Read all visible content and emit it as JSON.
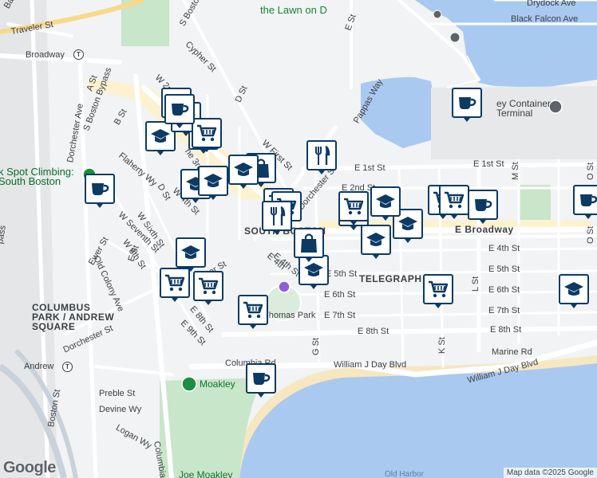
{
  "map": {
    "labels": [
      {
        "id": "traveler-st",
        "text": "Traveler St"
      },
      {
        "id": "broadway-west",
        "text": "Broadway"
      },
      {
        "id": "a-st",
        "text": "A St"
      },
      {
        "id": "dorchester-ave",
        "text": "Dorchester Ave"
      },
      {
        "id": "s-boston-bypass",
        "text": "S Boston Bypass"
      },
      {
        "id": "b-st",
        "text": "B St"
      },
      {
        "id": "s-boston-st",
        "text": "S Boston St"
      },
      {
        "id": "cypher-st",
        "text": "Cypher St"
      },
      {
        "id": "w-2nd-st",
        "text": "W 2nd St"
      },
      {
        "id": "the-lawn-on-d",
        "text": "the Lawn on D"
      },
      {
        "id": "e-st-north",
        "text": "E St"
      },
      {
        "id": "drydock-ave",
        "text": "Drydock Ave"
      },
      {
        "id": "black-falcon-ave",
        "text": "Black Falcon Ave"
      },
      {
        "id": "pappas-way",
        "text": "Pappas Way"
      },
      {
        "id": "d-st",
        "text": "D St"
      },
      {
        "id": "w-first-st",
        "text": "W First St"
      },
      {
        "id": "e-1st-st-a",
        "text": "E 1st St"
      },
      {
        "id": "e-1st-st-b",
        "text": "E 1st St"
      },
      {
        "id": "container-terminal",
        "text": "ey Container\nTerminal"
      },
      {
        "id": "climbing",
        "text": "k Spot Climbing:\nSouth Boston"
      },
      {
        "id": "flaherty-wy",
        "text": "Flaherty Wy"
      },
      {
        "id": "w-seventh-st",
        "text": "W Seventh St"
      },
      {
        "id": "w-sixth-st",
        "text": "W Sixth St"
      },
      {
        "id": "w-8th-st",
        "text": "W 8th St"
      },
      {
        "id": "old-colony-ave",
        "text": "Old Colony Ave"
      },
      {
        "id": "ewer-st",
        "text": "Ewer St"
      },
      {
        "id": "e-st-west",
        "text": "E St"
      },
      {
        "id": "columbus-park",
        "text": "COLUMBUS\nPARK / ANDREW\nSQUARE"
      },
      {
        "id": "dorchester-st-a",
        "text": "Dorchester St"
      },
      {
        "id": "dorchester-st-b",
        "text": "Dorchester St"
      },
      {
        "id": "e-2nd-st",
        "text": "E 2nd St"
      },
      {
        "id": "e-broadway",
        "text": "E Broadway"
      },
      {
        "id": "south-boston",
        "text": "SOUTH BOSTON"
      },
      {
        "id": "e-4th-st-a",
        "text": "E 4th St"
      },
      {
        "id": "e-4th-st-b",
        "text": "E 4th St"
      },
      {
        "id": "e-5th-st-a",
        "text": "E 5th St"
      },
      {
        "id": "e-5th-st-b",
        "text": "E 5th St"
      },
      {
        "id": "telegraph-hill",
        "text": "TELEGRAPH"
      },
      {
        "id": "e-6th-st-a",
        "text": "E 6th St"
      },
      {
        "id": "e-6th-st-b",
        "text": "E 6th St"
      },
      {
        "id": "e-7th-st-a",
        "text": "E 7th St"
      },
      {
        "id": "e-7th-st-b",
        "text": "E 7th St"
      },
      {
        "id": "e-8th-st-a",
        "text": "E 8th St"
      },
      {
        "id": "e-8th-st-b",
        "text": "E 8th St"
      },
      {
        "id": "e-8th-st-west",
        "text": "E 8th St"
      },
      {
        "id": "e-9th-st",
        "text": "E 9th St"
      },
      {
        "id": "thomas-park",
        "text": "Thomas Park"
      },
      {
        "id": "marine-rd",
        "text": "Marine Rd"
      },
      {
        "id": "g-st",
        "text": "G St"
      },
      {
        "id": "k-st",
        "text": "K St"
      },
      {
        "id": "l-st",
        "text": "L St"
      },
      {
        "id": "m-st",
        "text": "M St"
      },
      {
        "id": "o-st-a",
        "text": "O St"
      },
      {
        "id": "o-st-b",
        "text": "O St"
      },
      {
        "id": "andrew",
        "text": "Andrew"
      },
      {
        "id": "columbia-rd",
        "text": "Columbia Rd"
      },
      {
        "id": "william-j-day-blvd-a",
        "text": "William J Day Blvd"
      },
      {
        "id": "william-j-day-blvd-b",
        "text": "William J Day Blvd"
      },
      {
        "id": "moakley",
        "text": "Moakley"
      },
      {
        "id": "joe-moakley",
        "text": "Joe Moakley"
      },
      {
        "id": "preble-st",
        "text": "Preble St"
      },
      {
        "id": "devine-wy",
        "text": "Devine Wy"
      },
      {
        "id": "logan-wy",
        "text": "Logan Wy"
      },
      {
        "id": "boston-st",
        "text": "Boston St"
      },
      {
        "id": "columbia-rd-south",
        "text": "Columbia R"
      },
      {
        "id": "old-harbor",
        "text": "Old Harbor"
      },
      {
        "id": "w-4th-st",
        "text": "W 4th St"
      },
      {
        "id": "d-st-south",
        "text": "D St"
      },
      {
        "id": "ter-st",
        "text": "ter St"
      },
      {
        "id": "he-3rd",
        "text": "he 3rd"
      },
      {
        "id": "e-4th-partial",
        "text": "E 4th"
      },
      {
        "id": "bass",
        "text": "Bass"
      },
      {
        "id": "pass",
        "text": "pass"
      }
    ],
    "pins": [
      {
        "type": "coffee"
      },
      {
        "type": "coffee"
      },
      {
        "type": "school"
      },
      {
        "type": "cart"
      },
      {
        "type": "school"
      },
      {
        "type": "school"
      },
      {
        "type": "cart"
      },
      {
        "type": "shopping-bag"
      },
      {
        "type": "school"
      },
      {
        "type": "cart"
      },
      {
        "type": "cart"
      },
      {
        "type": "restaurant"
      },
      {
        "type": "restaurant"
      },
      {
        "type": "shopping-bag"
      },
      {
        "type": "school"
      },
      {
        "type": "cart"
      },
      {
        "type": "school"
      },
      {
        "type": "cart"
      },
      {
        "type": "cart"
      },
      {
        "type": "cart"
      },
      {
        "type": "coffee"
      },
      {
        "type": "coffee"
      },
      {
        "type": "coffee"
      },
      {
        "type": "cart"
      },
      {
        "type": "school"
      },
      {
        "type": "school"
      },
      {
        "type": "cart"
      },
      {
        "type": "coffee"
      },
      {
        "type": "shopping-bag"
      },
      {
        "type": "school"
      },
      {
        "type": "cart"
      },
      {
        "type": "school"
      },
      {
        "type": "school"
      },
      {
        "type": "coffee"
      }
    ],
    "metro_stations": [
      {
        "name": "broadway",
        "symbol": "T"
      },
      {
        "name": "andrew",
        "symbol": "T"
      }
    ]
  },
  "footer": {
    "google_logo": "Google",
    "map_data": "Map data ©2025 Google"
  },
  "colors": {
    "water": "#a9c9f0",
    "land": "#f1f3f4",
    "park": "#c8e6c9",
    "commercial": "#fdf2d0",
    "beach": "#f6e7c1",
    "pin_border": "#0c3a63"
  }
}
